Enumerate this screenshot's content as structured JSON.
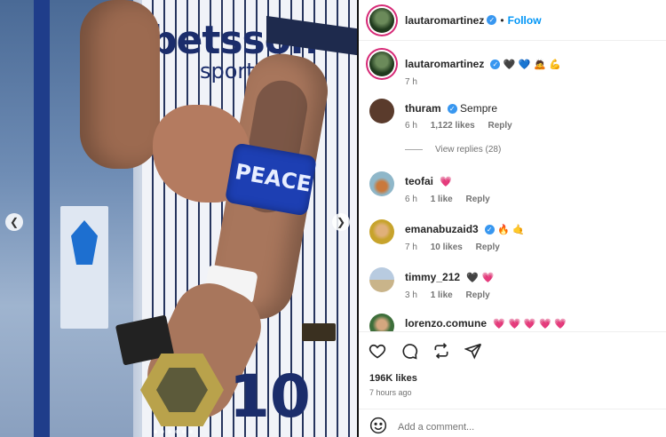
{
  "post": {
    "username": "lauta̲romartinez",
    "follow_label": "Follow",
    "separator": "•"
  },
  "caption": {
    "username": "lautaromartinez",
    "emojis": "🖤 💙 🙇 💪",
    "time": "7 h"
  },
  "comments": [
    {
      "username": "thuram",
      "verified": true,
      "text": "Sempre",
      "time": "6 h",
      "likes": "1,122 likes",
      "reply": "Reply",
      "avatar_color": "#5a3b2c"
    },
    {
      "username": "teofai",
      "verified": false,
      "text": "💗",
      "time": "6 h",
      "likes": "1 like",
      "reply": "Reply",
      "avatar_color": "#8fb7c9"
    },
    {
      "username": "emanabuzaid3",
      "verified": true,
      "text": "🔥 🤙",
      "time": "7 h",
      "likes": "10 likes",
      "reply": "Reply",
      "avatar_color": "#c7a32c"
    },
    {
      "username": "timmy_212",
      "verified": false,
      "text": "🖤 💗",
      "time": "3 h",
      "likes": "1 like",
      "reply": "Reply",
      "avatar_color": "#9ab0c4"
    },
    {
      "username": "lorenzo.comune",
      "verified": false,
      "text": "💗 💗 💗 💗 💗",
      "time": "",
      "likes": "",
      "reply": "",
      "avatar_color": "#3d6e3a"
    }
  ],
  "view_replies": "View replies (28)",
  "likes_count": "196K likes",
  "posted_ago": "7 hours ago",
  "add_comment": {
    "placeholder": "Add a comment..."
  },
  "media": {
    "armband_text": "PEACE",
    "jersey_text": "betsson",
    "jersey_subtext": "sport",
    "shirt_number": "10",
    "carousel_count": 6,
    "carousel_active": 0
  },
  "icons": {
    "heart": "heart-icon",
    "comment": "comment-icon",
    "share": "repost-icon",
    "send": "send-icon",
    "emoji": "emoji-icon",
    "prev": "chevron-left-icon",
    "next": "chevron-right-icon"
  },
  "colors": {
    "follow": "#0095f6",
    "verified": "#3897f0",
    "story_ring": "#d62976"
  }
}
